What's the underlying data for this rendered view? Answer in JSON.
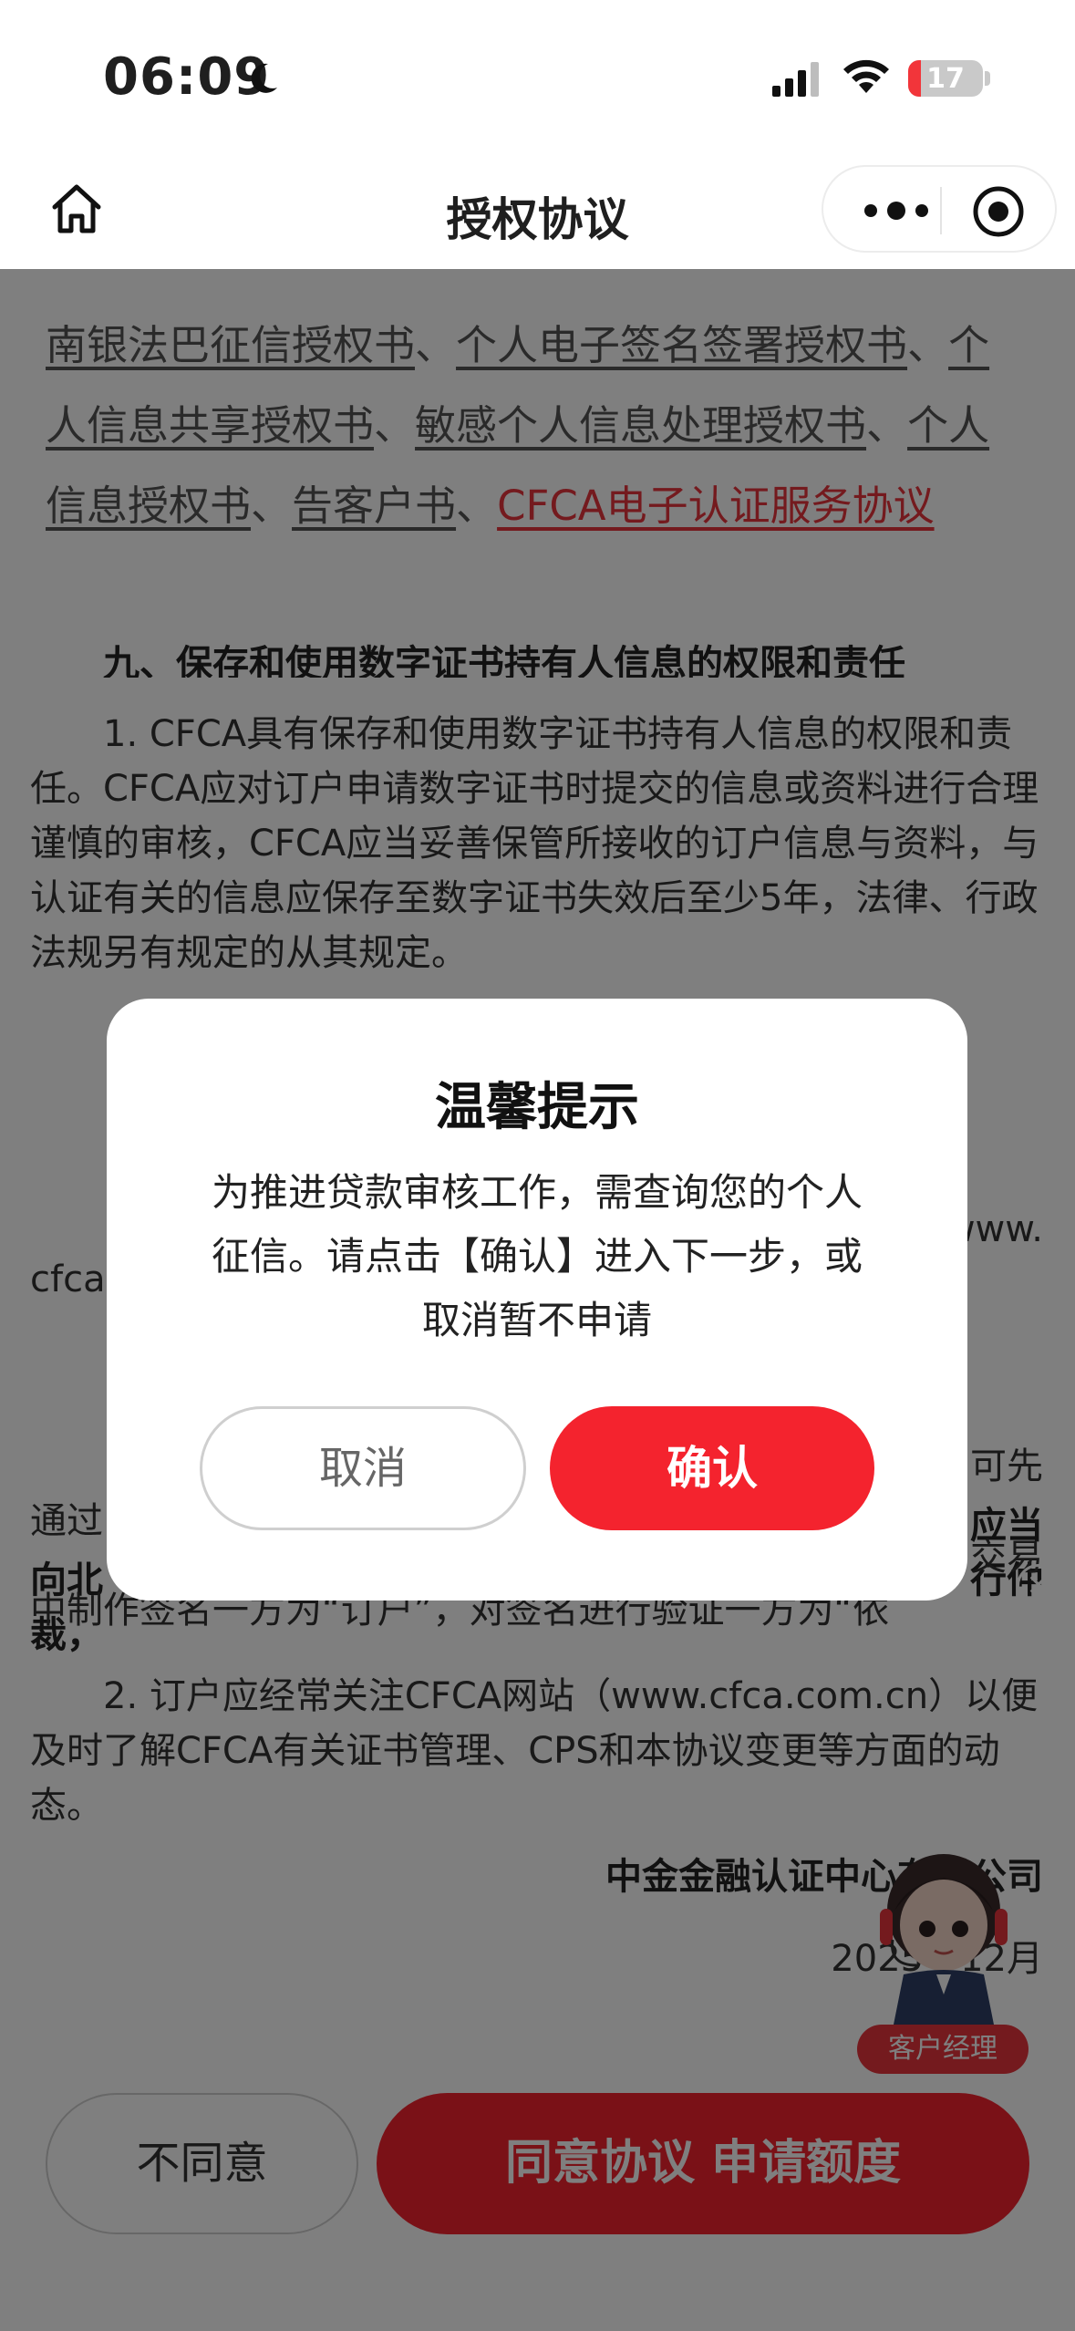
{
  "status_bar": {
    "time": "06:09",
    "battery_level": "17"
  },
  "nav": {
    "title": "授权协议"
  },
  "content": {
    "agreements": [
      {
        "label": "南银法巴征信授权书",
        "color": "#555555"
      },
      {
        "label": "个人电子签名签署授权书",
        "color": "#555555"
      },
      {
        "label": "个人信息共享授权书",
        "color": "#555555"
      },
      {
        "label": "敏感个人信息处理授权书",
        "color": "#555555"
      },
      {
        "label": "个人信息授权书",
        "color": "#555555"
      },
      {
        "label": "告客户书",
        "color": "#555555"
      },
      {
        "label": "CFCA电子认证服务协议",
        "color": "#e8343d"
      }
    ],
    "separator": "、",
    "section_heading": "九、保存和使用数字证书持有人信息的权限和责任",
    "para1": "1. CFCA具有保存和使用数字证书持有人信息的权限和责任。CFCA应对订户申请数字证书时提交的信息或资料进行合理谨慎的审核，CFCA应当妥善保管所接收的订户信息与资料，与认证有关的信息应保存至数字证书失效后至少5年，法律、行政法规另有规定的从其规定。",
    "frag_a_left": "cfca",
    "frag_a_right": "www.",
    "frag_b_line1_left": "通过",
    "frag_b_line1_right": "可先",
    "frag_b_line2_left": "向北",
    "frag_b_line2_right": "应当",
    "frag_b_line3_left": "裁，",
    "frag_b_line3_right": "行仲",
    "frag_c_right": "交易",
    "frag_c_line": "中制作签名一方为“订户”，对签名进行验证一方为“依",
    "para2": "2. 订户应经常关注CFCA网站（www.cfca.com.cn）以便及时了解CFCA有关证书管理、CPS和本协议变更等方面的动态。",
    "company": "中金金融认证中心有限公司",
    "date": "2025年12月"
  },
  "buttons": {
    "disagree": "不同意",
    "agree": "同意协议 申请额度"
  },
  "service": {
    "label": "客户经理",
    "close": "✕"
  },
  "dialog": {
    "title": "温馨提示",
    "message": "为推进贷款审核工作，需查询您的个人征信。请点击【确认】进入下一步，或取消暂不申请",
    "cancel": "取消",
    "confirm": "确认"
  },
  "colors": {
    "accent": "#f4232e",
    "link_red": "#e8343d",
    "overlay": "rgba(0,0,0,0.5)"
  },
  "icons": [
    "moon-icon",
    "signal-icon",
    "wifi-icon",
    "battery-icon",
    "home-icon",
    "more-icon",
    "target-icon",
    "close-icon"
  ]
}
